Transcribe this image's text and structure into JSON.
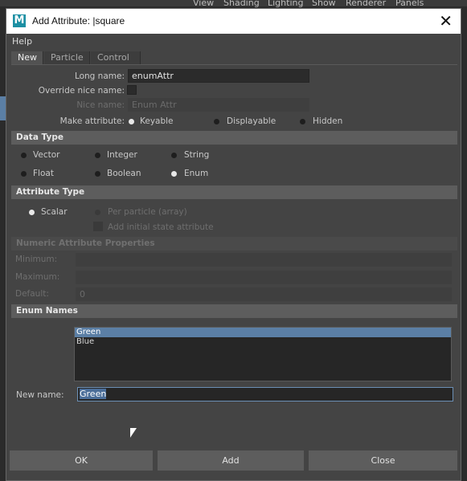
{
  "background_menus": [
    "View",
    "Shading",
    "Lighting",
    "Show",
    "Renderer",
    "Panels"
  ],
  "window": {
    "title": "Add Attribute: |square",
    "logo_letter": "M",
    "close_glyph": "✕"
  },
  "menubar": {
    "help": "Help"
  },
  "tabs": [
    "New",
    "Particle",
    "Control"
  ],
  "form": {
    "long_name_label": "Long name:",
    "long_name_value": "enumAttr",
    "override_label": "Override nice name:",
    "nice_name_label": "Nice name:",
    "nice_name_value": "Enum Attr",
    "make_attribute_label": "Make attribute:",
    "make_attribute_options": [
      "Keyable",
      "Displayable",
      "Hidden"
    ],
    "make_attribute_selected": "Keyable"
  },
  "data_type": {
    "title": "Data Type",
    "options": [
      "Vector",
      "Integer",
      "String",
      "Float",
      "Boolean",
      "Enum"
    ],
    "selected": "Enum"
  },
  "attribute_type": {
    "title": "Attribute Type",
    "scalar": "Scalar",
    "per_particle": "Per particle (array)",
    "add_initial": "Add initial state attribute",
    "selected": "Scalar"
  },
  "numeric": {
    "title": "Numeric Attribute Properties",
    "minimum": "Minimum:",
    "maximum": "Maximum:",
    "default": "Default:",
    "default_value": "0"
  },
  "enum_names": {
    "title": "Enum Names",
    "items": [
      "Green",
      "Blue"
    ],
    "selected": "Green",
    "new_name_label": "New name:",
    "new_name_value": "Green"
  },
  "buttons": {
    "ok": "OK",
    "add": "Add",
    "close": "Close"
  }
}
